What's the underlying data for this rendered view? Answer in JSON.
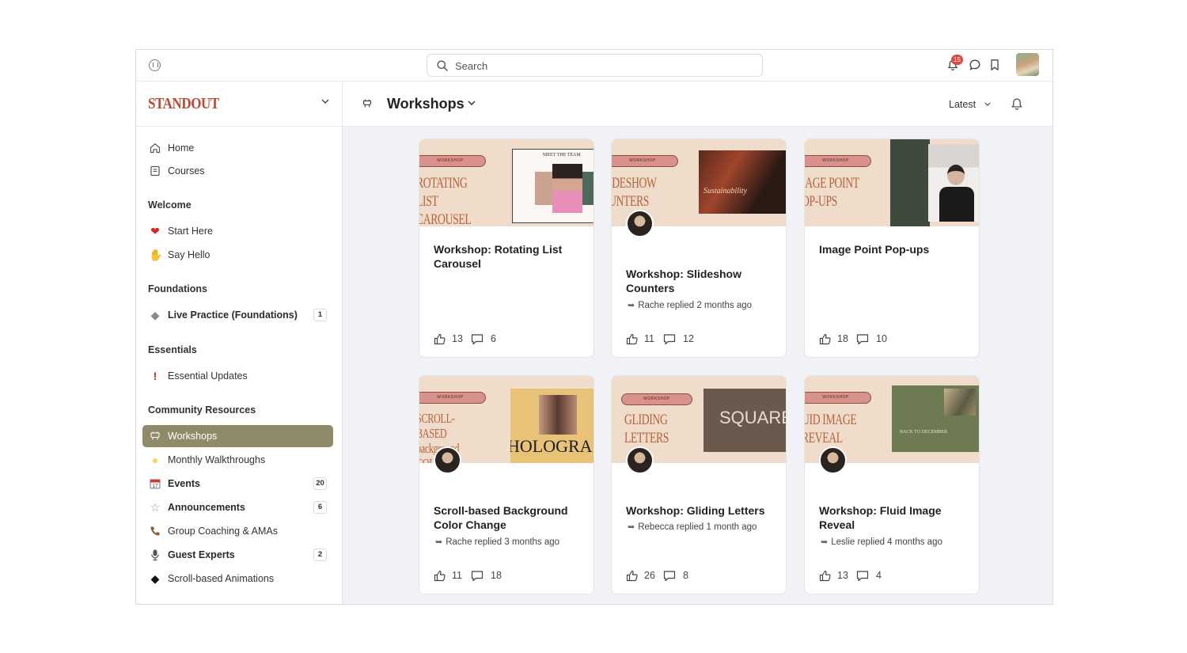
{
  "topbar": {
    "search_placeholder": "Search",
    "notification_count": "15"
  },
  "sidebar": {
    "brand": "STANDOUT",
    "items_top": [
      {
        "label": "Home",
        "icon": "home-icon"
      },
      {
        "label": "Courses",
        "icon": "courses-icon"
      }
    ],
    "sections": [
      {
        "heading": "Welcome",
        "items": [
          {
            "label": "Start Here",
            "icon": "heart-icon"
          },
          {
            "label": "Say Hello",
            "icon": "wave-hand-icon"
          }
        ]
      },
      {
        "heading": "Foundations",
        "items": [
          {
            "label": "Live Practice (Foundations)",
            "icon": "diamond-icon",
            "count": "1",
            "bold": true
          }
        ]
      },
      {
        "heading": "Essentials",
        "items": [
          {
            "label": "Essential Updates",
            "icon": "exclamation-icon"
          }
        ]
      },
      {
        "heading": "Community Resources",
        "items": [
          {
            "label": "Workshops",
            "icon": "workshop-icon",
            "active": true
          },
          {
            "label": "Monthly Walkthroughs",
            "icon": "lightbulb-icon"
          },
          {
            "label": "Events",
            "icon": "calendar-icon",
            "count": "20",
            "bold": true
          },
          {
            "label": "Announcements",
            "icon": "star-icon",
            "count": "6",
            "bold": true
          },
          {
            "label": "Group Coaching & AMAs",
            "icon": "phone-icon"
          },
          {
            "label": "Guest Experts",
            "icon": "microphone-icon",
            "count": "2",
            "bold": true
          },
          {
            "label": "Scroll-based Animations",
            "icon": "black-diamond-icon"
          }
        ]
      }
    ]
  },
  "main": {
    "title": "Workshops",
    "sort": "Latest",
    "cards": [
      {
        "badge": "WORKSHOP",
        "thumb_text": "ROTATING LIST CAROUSEL",
        "thumb_caption": "MEET THE TEAM",
        "title": "Workshop: Rotating List Carousel",
        "reply": "",
        "likes": "13",
        "comments": "6"
      },
      {
        "badge": "WORKSHOP",
        "thumb_text": "IDESHOW UNTERS",
        "thumb_caption": "Sustainability",
        "title": "Workshop: Slideshow Counters",
        "reply": "Rache replied 2 months ago",
        "likes": "11",
        "comments": "12"
      },
      {
        "badge": "WORKSHOP",
        "thumb_text": "IAGE POINT OP-UPS",
        "thumb_caption": "",
        "title": "Image Point Pop-ups",
        "reply": "",
        "likes": "18",
        "comments": "10"
      },
      {
        "badge": "WORKSHOP",
        "thumb_text": "SCROLL-BASED background COLOR CHANGE",
        "thumb_caption": "HOLOGRA",
        "title": "Scroll-based Background Color Change",
        "reply": "Rache replied 3 months ago",
        "likes": "11",
        "comments": "18"
      },
      {
        "badge": "WORKSHOP",
        "thumb_text": "GLIDING LETTERS",
        "thumb_caption": "SQUARE",
        "title": "Workshop: Gliding Letters",
        "reply": "Rebecca replied 1 month ago",
        "likes": "26",
        "comments": "8"
      },
      {
        "badge": "WORKSHOP",
        "thumb_text": "UID IMAGE REVEAL",
        "thumb_caption": "BACK TO DECEMBER",
        "title": "Workshop: Fluid Image Reveal",
        "reply": "Leslie replied 4 months ago",
        "likes": "13",
        "comments": "4"
      }
    ]
  },
  "colors": {
    "brand": "#c2472f",
    "active_nav": "#8f8b6a",
    "thumb_bg": "#efdccb",
    "badge_pink": "#d8918b",
    "notification_red": "#e04a3a"
  }
}
